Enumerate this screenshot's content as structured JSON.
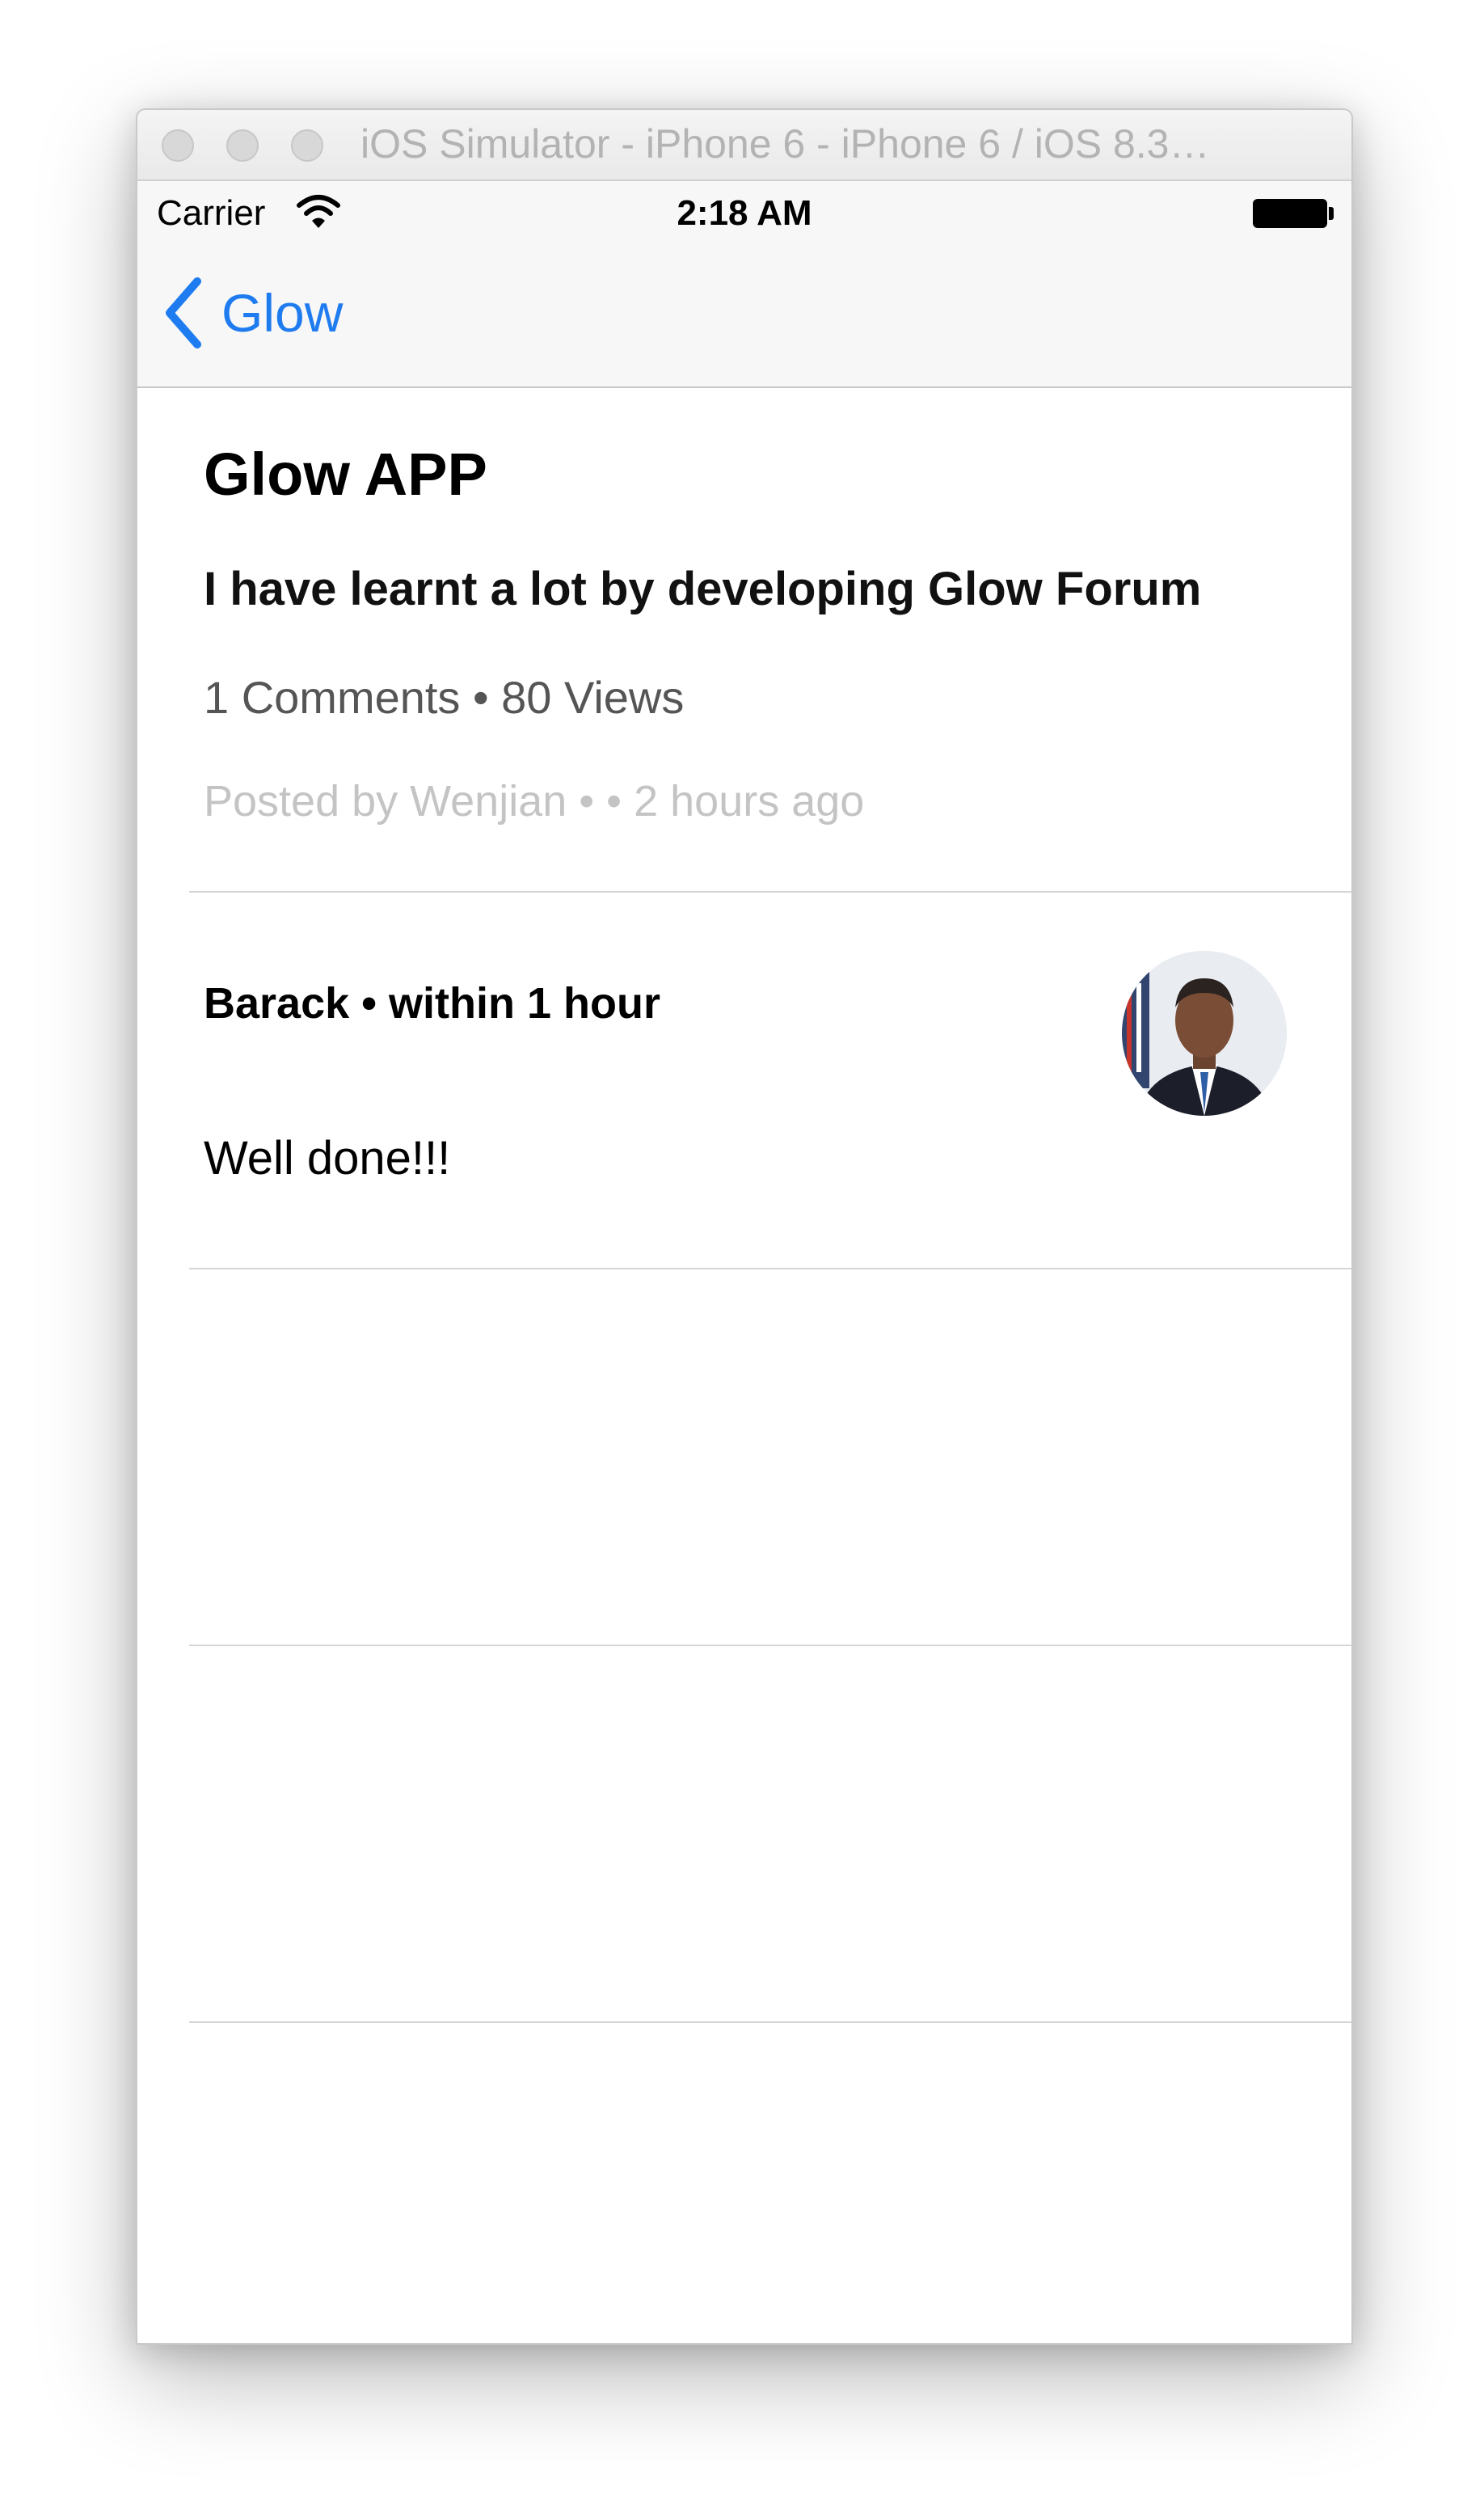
{
  "window": {
    "title": "iOS Simulator - iPhone 6 - iPhone 6 / iOS 8.3…"
  },
  "status_bar": {
    "carrier": "Carrier",
    "time": "2:18 AM",
    "icons": [
      "wifi-icon",
      "battery-icon"
    ]
  },
  "nav": {
    "back_label": "Glow",
    "back_icon": "chevron-left-icon",
    "accent_color": "#1f7cf0"
  },
  "post": {
    "title": "Glow APP",
    "body": "I have learnt a lot by developing Glow Forum",
    "stats": "1 Comments • 80 Views",
    "meta": "Posted by Wenjian •  • 2 hours ago"
  },
  "comments": [
    {
      "author_line": "Barack • within 1 hour",
      "text": "Well done!!!",
      "avatar": "avatar-photo"
    }
  ]
}
